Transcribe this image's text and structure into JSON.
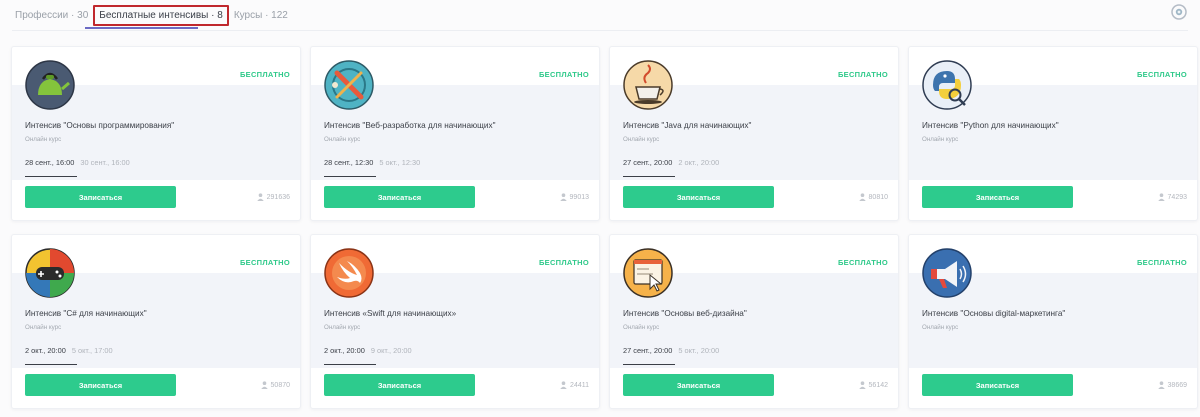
{
  "tabs": [
    {
      "label": "Профессии · 30"
    },
    {
      "label": "Бесплатные интенсивы · 8"
    },
    {
      "label": "Курсы · 122"
    }
  ],
  "cards": [
    {
      "badge": "БЕСПЛАТНО",
      "title": "Интенсив \"Основы программирования\"",
      "subtitle": "Онлайн курс",
      "date_start": "28 сент., 16:00",
      "date_end": "30 сент., 16:00",
      "button": "Записаться",
      "count": "291636",
      "icon": "kettle-icon"
    },
    {
      "badge": "БЕСПЛАТНО",
      "title": "Интенсив \"Веб-разработка для начинающих\"",
      "subtitle": "Онлайн курс",
      "date_start": "28 сент., 12:30",
      "date_end": "5 окт., 12:30",
      "button": "Записаться",
      "count": "99013",
      "icon": "web-tools-icon"
    },
    {
      "badge": "БЕСПЛАТНО",
      "title": "Интенсив \"Java для начинающих\"",
      "subtitle": "Онлайн курс",
      "date_start": "27 сент., 20:00",
      "date_end": "2 окт., 20:00",
      "button": "Записаться",
      "count": "80810",
      "icon": "java-cup-icon"
    },
    {
      "badge": "БЕСПЛАТНО",
      "title": "Интенсив \"Python для начинающих\"",
      "subtitle": "Онлайн курс",
      "date_start": "",
      "date_end": "",
      "button": "Записаться",
      "count": "74293",
      "icon": "python-icon"
    },
    {
      "badge": "БЕСПЛАТНО",
      "title": "Интенсив \"C# для начинающих\"",
      "subtitle": "Онлайн курс",
      "date_start": "2 окт., 20:00",
      "date_end": "5 окт., 17:00",
      "button": "Записаться",
      "count": "50870",
      "icon": "gamepad-icon"
    },
    {
      "badge": "БЕСПЛАТНО",
      "title": "Интенсив «Swift для начинающих»",
      "subtitle": "Онлайн курс",
      "date_start": "2 окт., 20:00",
      "date_end": "9 окт., 20:00",
      "button": "Записаться",
      "count": "24411",
      "icon": "swift-icon"
    },
    {
      "badge": "БЕСПЛАТНО",
      "title": "Интенсив \"Основы веб-дизайна\"",
      "subtitle": "Онлайн курс",
      "date_start": "27 сент., 20:00",
      "date_end": "5 окт., 20:00",
      "button": "Записаться",
      "count": "56142",
      "icon": "web-design-icon"
    },
    {
      "badge": "БЕСПЛАТНО",
      "title": "Интенсив \"Основы digital-маркетинга\"",
      "subtitle": "Онлайн курс",
      "date_start": "",
      "date_end": "",
      "button": "Записаться",
      "count": "38669",
      "icon": "megaphone-icon"
    }
  ]
}
